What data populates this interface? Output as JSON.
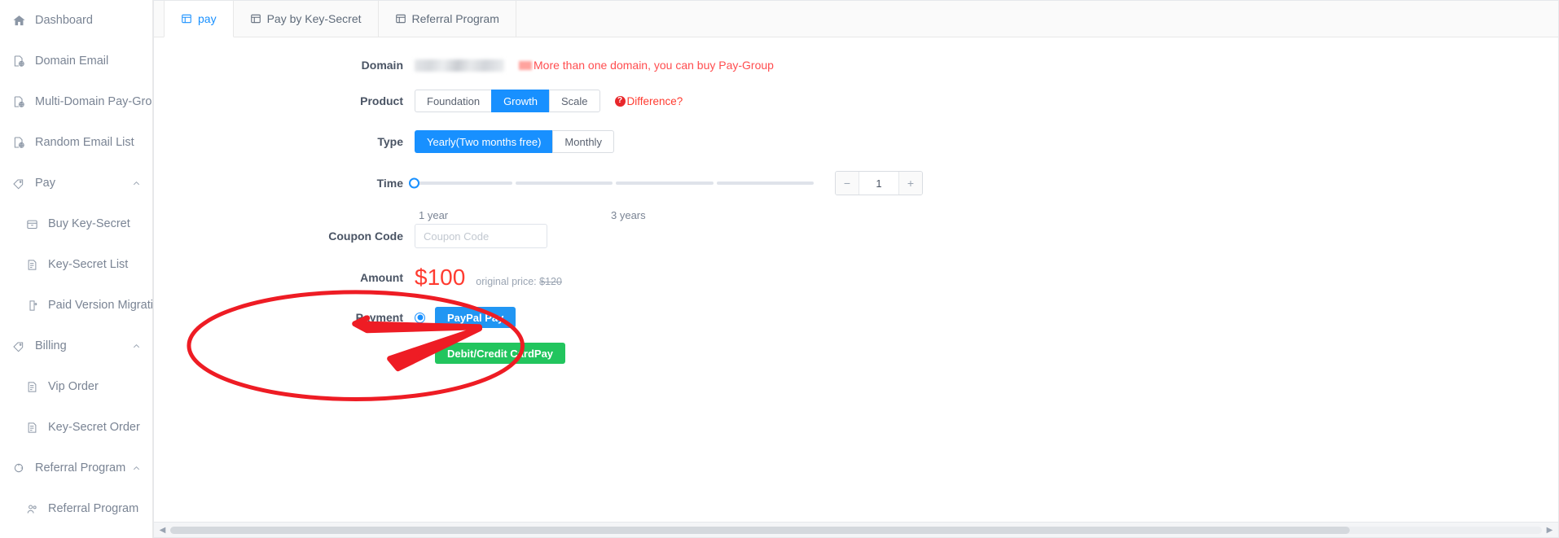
{
  "sidebar": {
    "items": [
      {
        "label": "Dashboard",
        "icon": "home-icon",
        "level": "top",
        "collapsible": false
      },
      {
        "label": "Domain Email",
        "icon": "domain-email-icon",
        "level": "top",
        "collapsible": false
      },
      {
        "label": "Multi-Domain Pay-Group",
        "icon": "domain-email-icon",
        "level": "top",
        "collapsible": false
      },
      {
        "label": "Random Email List",
        "icon": "domain-email-icon",
        "level": "top",
        "collapsible": false
      },
      {
        "label": "Pay",
        "icon": "tag-icon",
        "level": "top",
        "collapsible": true,
        "caret": "chevron-up-icon"
      },
      {
        "label": "Buy Key-Secret",
        "icon": "wallet-icon",
        "level": "sub",
        "collapsible": false
      },
      {
        "label": "Key-Secret List",
        "icon": "list-icon",
        "level": "sub",
        "collapsible": false
      },
      {
        "label": "Paid Version Migration",
        "icon": "migration-icon",
        "level": "sub",
        "collapsible": false
      },
      {
        "label": "Billing",
        "icon": "tag-icon",
        "level": "top",
        "collapsible": true,
        "caret": "chevron-up-icon"
      },
      {
        "label": "Vip Order",
        "icon": "list-icon",
        "level": "sub",
        "collapsible": false
      },
      {
        "label": "Key-Secret Order",
        "icon": "list-icon",
        "level": "sub",
        "collapsible": false
      },
      {
        "label": "Referral Program",
        "icon": "share-icon",
        "level": "top",
        "collapsible": true,
        "caret": "chevron-up-icon"
      },
      {
        "label": "Referral Program",
        "icon": "users-icon",
        "level": "sub",
        "collapsible": false
      }
    ]
  },
  "tabs": [
    {
      "label": "pay",
      "icon": "table-icon",
      "active": true
    },
    {
      "label": "Pay by Key-Secret",
      "icon": "table-icon",
      "active": false
    },
    {
      "label": "Referral Program",
      "icon": "table-icon",
      "active": false
    }
  ],
  "form": {
    "domain": {
      "label": "Domain",
      "value": "",
      "hint": "More than one domain, you can buy Pay-Group"
    },
    "product": {
      "label": "Product",
      "options": [
        "Foundation",
        "Growth",
        "Scale"
      ],
      "selected": "Growth",
      "difference_link": "Difference?"
    },
    "type": {
      "label": "Type",
      "options": [
        "Yearly(Two months free)",
        "Monthly"
      ],
      "selected": "Yearly(Two months free)"
    },
    "time": {
      "label": "Time",
      "min_label": "1 year",
      "max_label": "3 years",
      "value": "1",
      "decrement": "−",
      "increment": "+"
    },
    "coupon": {
      "label": "Coupon Code",
      "value": "",
      "placeholder": "Coupon Code"
    },
    "amount": {
      "label": "Amount",
      "price": "$100",
      "original_label": "original price:",
      "original_price": "$120"
    },
    "payment": {
      "label": "Payment",
      "options": [
        {
          "label": "PayPal Pay",
          "selected": true,
          "color": "#2196f3"
        },
        {
          "label": "Debit/Credit CardPay",
          "selected": false,
          "color": "#22c55e"
        }
      ]
    }
  },
  "annotations": {
    "highlight_color": "#ee1c24",
    "ellipse": "payment-methods-highlight",
    "arrows": [
      "arrow-to-paypal-pay",
      "arrow-to-debit-credit-cardpay"
    ]
  },
  "scrollbar": {
    "left_arrow": "◀",
    "right_arrow": "▶"
  }
}
